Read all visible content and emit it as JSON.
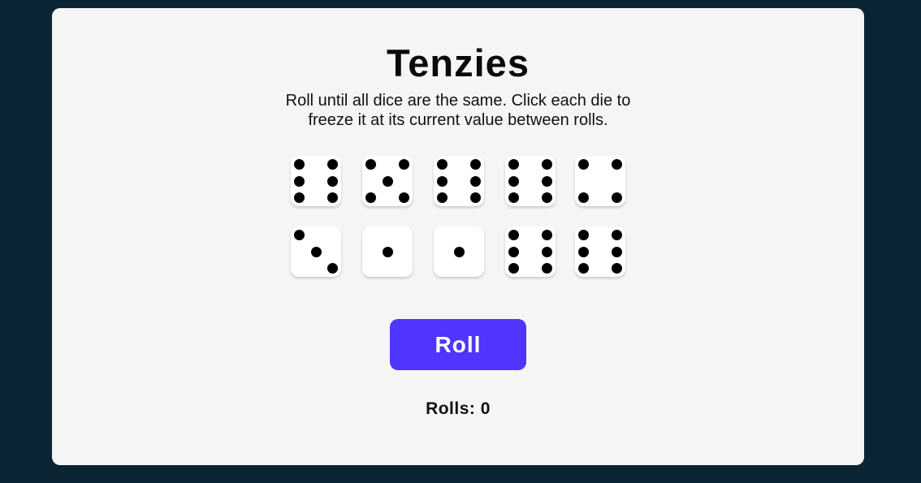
{
  "game": {
    "title": "Tenzies",
    "instructions_line1": "Roll until all dice are the same. Click each die to",
    "instructions_line2": "freeze it at its current value between rolls.",
    "dice": [
      6,
      5,
      6,
      6,
      4,
      3,
      1,
      1,
      6,
      6
    ],
    "held": [
      false,
      false,
      false,
      false,
      false,
      false,
      false,
      false,
      false,
      false
    ],
    "roll_label": "Roll",
    "rolls_label": "Rolls: 0"
  },
  "colors": {
    "background": "#0B2434",
    "card": "#F5F5F5",
    "button": "#5035FF",
    "die": "#FFFFFF",
    "pip": "#000000"
  }
}
